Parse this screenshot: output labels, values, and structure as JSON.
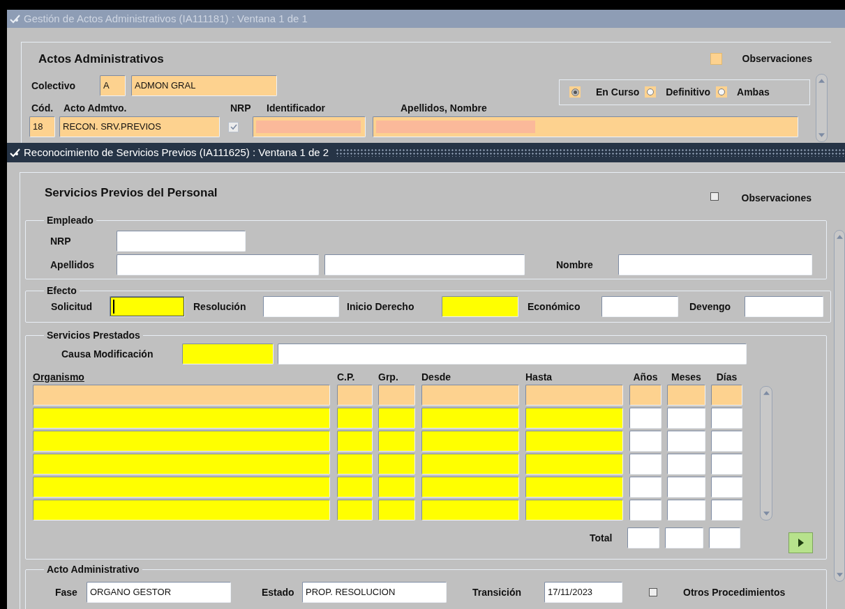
{
  "back_window": {
    "title": "Gestión de Actos Administrativos (IA111181) : Ventana 1 de 1",
    "heading": "Actos Administrativos",
    "observaciones": {
      "label": "Observaciones",
      "checked": false
    },
    "colectivo": {
      "label": "Colectivo",
      "code": "A",
      "name": "ADMON GRAL"
    },
    "filter": [
      {
        "label": "En Curso",
        "selected": true
      },
      {
        "label": "Definitivo",
        "selected": false
      },
      {
        "label": "Ambas",
        "selected": false
      }
    ],
    "columns": [
      "Cód.",
      "Acto Admtvo.",
      "NRP",
      "Identificador",
      "Apellidos, Nombre"
    ],
    "record": {
      "cod": "18",
      "acto": "RECON. SRV.PREVIOS",
      "nrp_checked": true
    }
  },
  "front_window": {
    "title": "Reconocimiento de Servicios Previos (IA111625) : Ventana 1 de 2",
    "heading": "Servicios Previos del Personal",
    "observaciones": {
      "label": "Observaciones",
      "checked": false
    },
    "empleado": {
      "legend": "Empleado",
      "nrp_label": "NRP",
      "apellidos_label": "Apellidos",
      "nombre_label": "Nombre"
    },
    "efecto": {
      "legend": "Efecto",
      "fields": [
        {
          "label": "Solicitud",
          "kind": "required",
          "focused": true
        },
        {
          "label": "Resolución",
          "kind": "optional",
          "focused": false
        },
        {
          "label": "Inicio Derecho",
          "kind": "required",
          "focused": false
        },
        {
          "label": "Económico",
          "kind": "optional",
          "focused": false
        },
        {
          "label": "Devengo",
          "kind": "optional",
          "focused": false
        }
      ]
    },
    "servicios": {
      "legend": "Servicios Prestados",
      "causa_label": "Causa Modificación",
      "columns": [
        "Organismo",
        "C.P.",
        "Grp.",
        "Desde",
        "Hasta",
        "Años",
        "Meses",
        "Días"
      ],
      "rows": [
        {
          "selected": true
        },
        {
          "selected": false
        },
        {
          "selected": false
        },
        {
          "selected": false
        },
        {
          "selected": false
        },
        {
          "selected": false
        }
      ],
      "total_label": "Total"
    },
    "acto": {
      "legend": "Acto Administrativo",
      "fields": [
        {
          "label": "Fase",
          "value": "ORGANO GESTOR"
        },
        {
          "label": "Estado",
          "value": "PROP. RESOLUCION"
        },
        {
          "label": "Transición",
          "value": "17/11/2023"
        }
      ],
      "otros": {
        "label": "Otros Procedimientos",
        "checked": false
      }
    }
  }
}
